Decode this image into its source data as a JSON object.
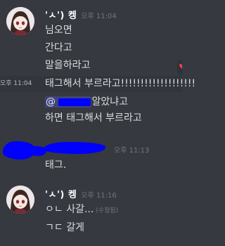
{
  "group1": {
    "username": "'ㅅ') 켕",
    "timestamp": "오후 11:04",
    "lines": [
      "님오면",
      "간다고",
      "말을하라고",
      "태그해서 부르라고!!!!!!!!!!!!!!!!!!!"
    ],
    "hover_time": "오후 11:04",
    "mention_line": {
      "mention_prefix": "@",
      "after": "알았냐고"
    },
    "last_line": "하면 태그해서 부르라고"
  },
  "group2": {
    "timestamp": "오후 11:13",
    "lines": [
      "태그."
    ]
  },
  "group3": {
    "username": "'ㅅ') 켕",
    "timestamp": "오후 11:16",
    "lines": [
      "ㅇㄴ 사갈..."
    ],
    "edited_label": "(수정됨)",
    "line2": "ㄱㄷ 갈게"
  },
  "colors": {
    "background": "#36393f",
    "hover_background": "#32353b",
    "text": "#dcddde",
    "username": "#ffffff",
    "timestamp": "#72767d",
    "mention_bg": "rgba(88,101,242,0.3)",
    "redaction": "#0000ff"
  }
}
